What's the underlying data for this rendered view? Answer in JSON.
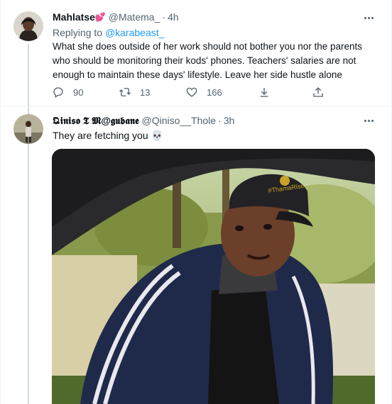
{
  "tweet1": {
    "display_name": "Mahlatse",
    "name_emoji": "💕",
    "handle": "@Matema_",
    "time": "4h",
    "replying_prefix": "Replying to",
    "replying_to": "@karabeast_",
    "text_line1": "What she does outside of her work should not bother you nor the parents",
    "text_line2": "who should be monitoring their kods' phones. Teachers' salaries are not",
    "text_line3": "enough to maintain these days' lifestyle. Leave her side hustle alone",
    "replies": "90",
    "retweets": "13",
    "likes": "166"
  },
  "tweet2": {
    "display_name": "𝕼𝖎𝖓𝖎𝖘𝖔 𝕿 𝕸@𝖌𝖚𝖇𝖆𝖓𝖊",
    "handle": "@Qiniso__Thole",
    "time": "3h",
    "text": "They are fetching you 💀"
  },
  "icons": [
    "reply-icon",
    "retweet-icon",
    "like-icon",
    "share-icon",
    "upload-icon",
    "more-icon"
  ],
  "colors": {
    "link": "#1d9bf0",
    "secondary_text": "#536471",
    "primary_text": "#0f1419"
  }
}
